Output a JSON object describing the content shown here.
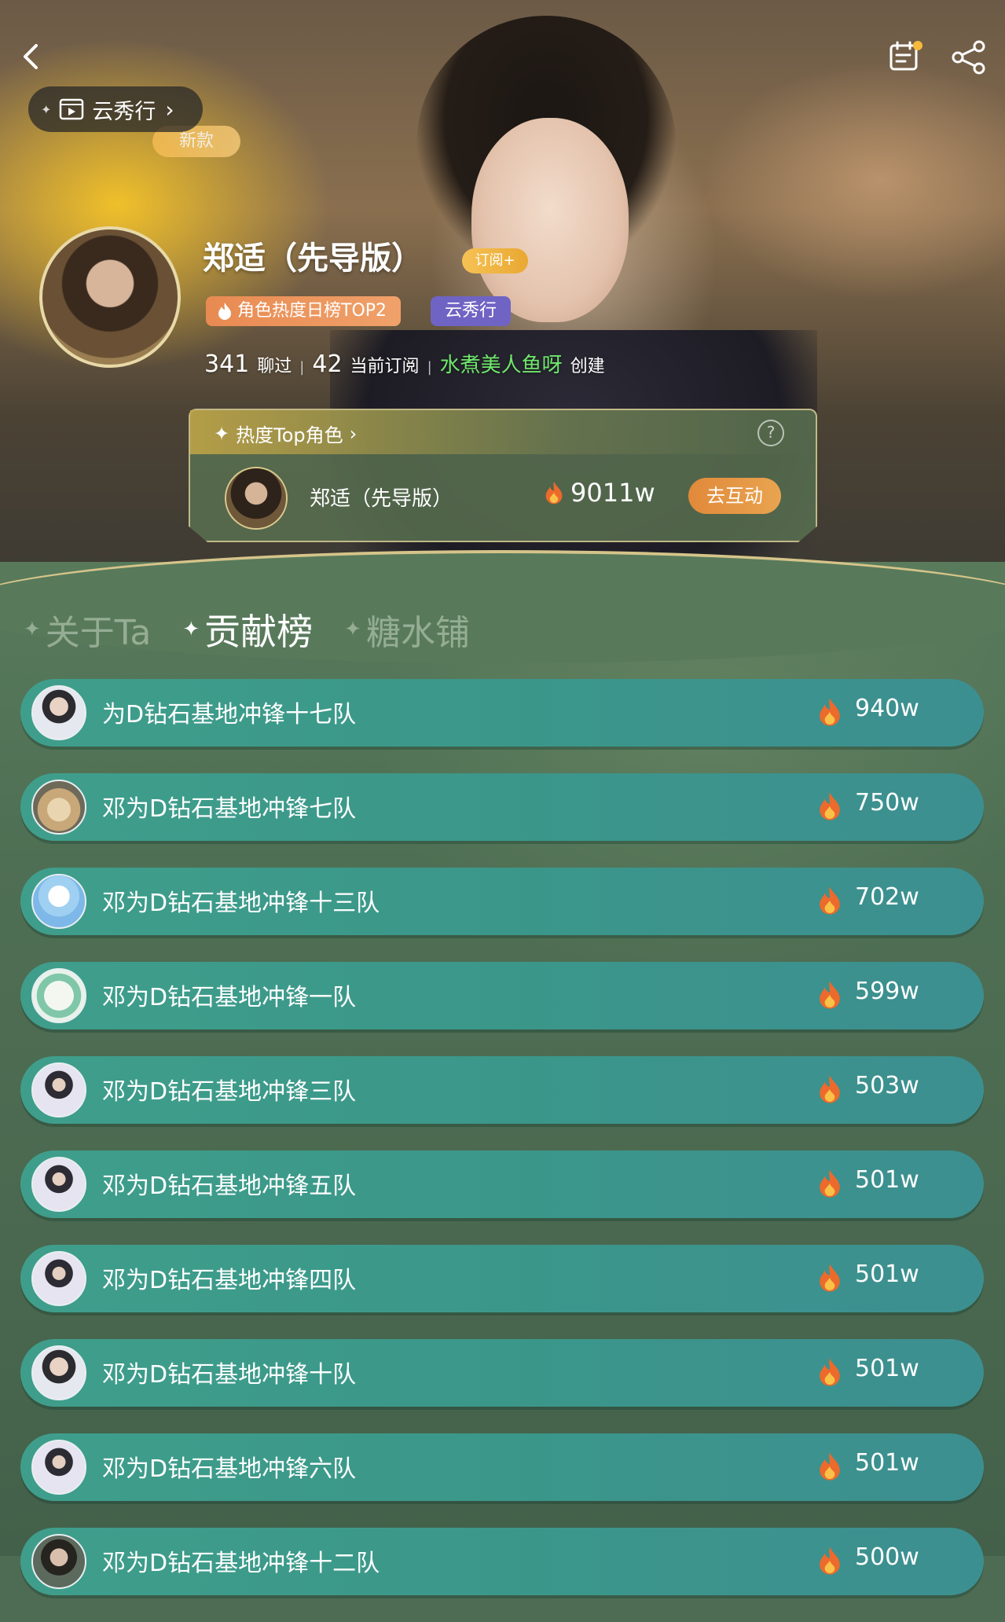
{
  "header": {
    "back_icon": "chevron-left-icon",
    "calendar_icon": "calendar-icon",
    "share_icon": "share-icon",
    "notification_dot_color": "#f6b93a",
    "yunxiu_label": "云秀行",
    "new_badge": "新款"
  },
  "profile": {
    "name": "郑适（先导版）",
    "subscribe_label": "订阅+",
    "hot_tag": "角色热度日榜TOP2",
    "yun_tag": "云秀行",
    "chatted_count": "341",
    "chatted_label": "聊过",
    "subscribers_count": "42",
    "subscribers_label": "当前订阅",
    "creator": "水煮美人鱼呀",
    "created_label": "创建"
  },
  "top_card": {
    "title": "热度Top角色",
    "name": "郑适（先导版）",
    "heat": "9011w",
    "button_label": "去互动"
  },
  "tabs": [
    {
      "label": "关于Ta",
      "active": false
    },
    {
      "label": "贡献榜",
      "active": true
    },
    {
      "label": "糖水铺",
      "active": false
    }
  ],
  "ranking": [
    {
      "name": "为D钻石基地冲锋十七队",
      "value": "940w"
    },
    {
      "name": "邓为D钻石基地冲锋七队",
      "value": "750w"
    },
    {
      "name": "邓为D钻石基地冲锋十三队",
      "value": "702w"
    },
    {
      "name": "邓为D钻石基地冲锋一队",
      "value": "599w"
    },
    {
      "name": "邓为D钻石基地冲锋三队",
      "value": "503w"
    },
    {
      "name": "邓为D钻石基地冲锋五队",
      "value": "501w"
    },
    {
      "name": "邓为D钻石基地冲锋四队",
      "value": "501w"
    },
    {
      "name": "邓为D钻石基地冲锋十队",
      "value": "501w"
    },
    {
      "name": "邓为D钻石基地冲锋六队",
      "value": "501w"
    },
    {
      "name": "邓为D钻石基地冲锋十二队",
      "value": "500w"
    }
  ],
  "colors": {
    "accent_orange": "#e9a450",
    "row_teal": "#3c978a",
    "background_green": "#4e6c53",
    "creator_green": "#6fe86a"
  }
}
